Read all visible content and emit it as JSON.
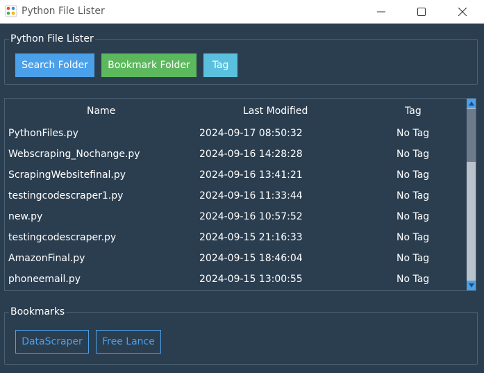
{
  "window": {
    "title": "Python File Lister"
  },
  "actions": {
    "group_label": "Python File Lister",
    "search_label": "Search Folder",
    "bookmark_label": "Bookmark Folder",
    "tag_label": "Tag"
  },
  "files": {
    "columns": {
      "name": "Name",
      "modified": "Last Modified",
      "tag": "Tag"
    },
    "rows": [
      {
        "name": "PythonFiles.py",
        "modified": "2024-09-17 08:50:32",
        "tag": "No Tag"
      },
      {
        "name": "Webscraping_Nochange.py",
        "modified": "2024-09-16 14:28:28",
        "tag": "No Tag"
      },
      {
        "name": "ScrapingWebsitefinal.py",
        "modified": "2024-09-16 13:41:21",
        "tag": "No Tag"
      },
      {
        "name": "testingcodescraper1.py",
        "modified": "2024-09-16 11:33:44",
        "tag": "No Tag"
      },
      {
        "name": "new.py",
        "modified": "2024-09-16 10:57:52",
        "tag": "No Tag"
      },
      {
        "name": "testingcodescraper.py",
        "modified": "2024-09-15 21:16:33",
        "tag": "No Tag"
      },
      {
        "name": "AmazonFinal.py",
        "modified": "2024-09-15 18:46:04",
        "tag": "No Tag"
      },
      {
        "name": "phoneemail.py",
        "modified": "2024-09-15 13:00:55",
        "tag": "No Tag"
      }
    ]
  },
  "bookmarks": {
    "group_label": "Bookmarks",
    "items": [
      {
        "label": "DataScraper"
      },
      {
        "label": "Free Lance"
      }
    ]
  },
  "theme": {
    "background": "#2b3e50",
    "primary": "#4ba0ea",
    "success": "#5cb85c",
    "info": "#5bc0de"
  },
  "icons": {
    "app": "app-icon",
    "minimize": "minimize-icon",
    "maximize": "maximize-icon",
    "close": "close-icon"
  }
}
